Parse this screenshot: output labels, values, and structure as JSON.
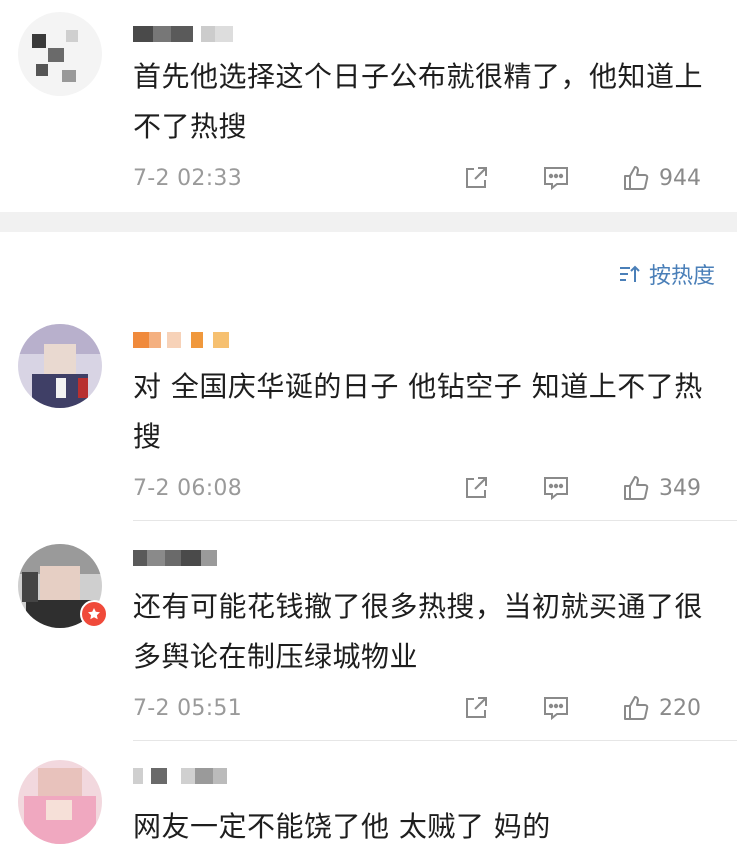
{
  "comments": [
    {
      "username_redacted": true,
      "text": "首先他选择这个日子公布就很精了，他知道上不了热搜",
      "timestamp": "7-2 02:33",
      "likes": "944"
    },
    {
      "username_redacted": true,
      "text": "对 全国庆华诞的日子 他钻空子 知道上不了热搜",
      "timestamp": "7-2 06:08",
      "likes": "349"
    },
    {
      "username_redacted": true,
      "text": "还有可能花钱撤了很多热搜，当初就买通了很多舆论在制压绿城物业",
      "timestamp": "7-2 05:51",
      "likes": "220"
    },
    {
      "username_redacted": true,
      "text": "网友一定不能饶了他 太贼了 妈的"
    }
  ],
  "sort": {
    "label": "按热度"
  },
  "icons": {
    "share": "share-icon",
    "comment": "comment-icon",
    "like": "thumbs-up-icon",
    "sort": "sort-icon",
    "badge": "vip-badge-icon"
  },
  "colors": {
    "accent": "#4a7fb8",
    "meta": "#9a9a9a",
    "badge": "#f04a3a",
    "section_gap": "#f1f1f1"
  }
}
